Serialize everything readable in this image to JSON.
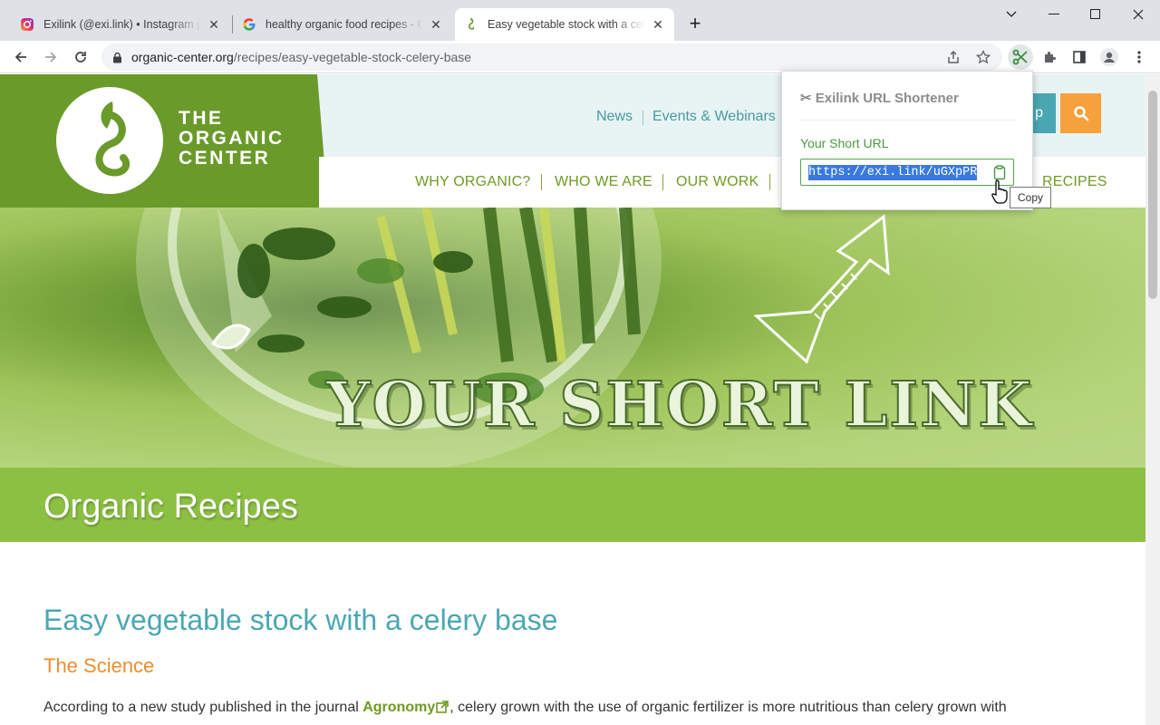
{
  "tabs": [
    {
      "title": "Exilink (@exi.link) • Instagram photos and videos",
      "icon": "instagram-icon"
    },
    {
      "title": "healthy organic food recipes - Google Search",
      "icon": "google-icon"
    },
    {
      "title": "Easy vegetable stock with a celery base",
      "icon": "organic-center-icon",
      "active": true
    }
  ],
  "address": {
    "host": "organic-center.org",
    "path": "/recipes/easy-vegetable-stock-celery-base"
  },
  "site": {
    "logo_line1": "THE",
    "logo_line2": "ORGANIC",
    "logo_line3": "CENTER",
    "top_nav": [
      "News",
      "Events & Webinars"
    ],
    "partial_button": "p",
    "main_nav": [
      "WHY ORGANIC?",
      "WHO WE ARE",
      "OUR WORK",
      "RECIPES"
    ],
    "hero_text": "YOUR SHORT LINK",
    "band_title": "Organic Recipes",
    "post_title": "Easy vegetable stock with a celery base",
    "post_subtitle": "The Science",
    "body_before_link": "According to a new study published in the journal ",
    "body_link": "Agronomy",
    "body_after_link": ", celery grown with the use of organic fertilizer is more nutritious than celery grown with"
  },
  "popup": {
    "title": "Exilink URL Shortener",
    "label": "Your Short URL",
    "short_url": "https://exi.link/uGXpPR",
    "tooltip": "Copy"
  },
  "colors": {
    "brand_green": "#6a9a2a",
    "accent_teal": "#4aa7b2",
    "accent_orange": "#ef8c2e",
    "band_green": "#8cc043"
  }
}
